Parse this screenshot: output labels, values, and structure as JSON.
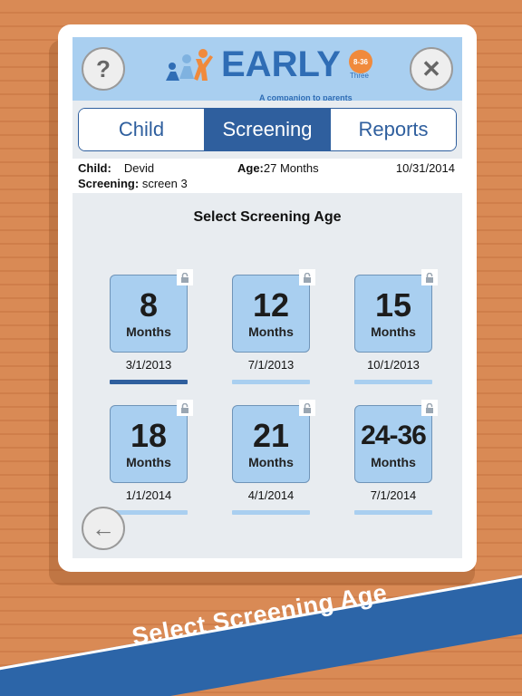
{
  "header": {
    "help_label": "?",
    "close_label": "✕",
    "logo_word": "EARLY",
    "logo_badge": "8-36",
    "logo_three": "Three",
    "tagline": "A companion to parents"
  },
  "tabs": [
    {
      "label": "Child",
      "active": false
    },
    {
      "label": "Screening",
      "active": true
    },
    {
      "label": "Reports",
      "active": false
    }
  ],
  "info": {
    "child_label": "Child:",
    "child_value": "Devid",
    "age_label": "Age:",
    "age_value": "27 Months",
    "date": "10/31/2014",
    "screening_label": "Screening:",
    "screening_value": "screen 3"
  },
  "screening": {
    "title": "Select Screening Age",
    "ages": [
      {
        "number": "8",
        "unit": "Months",
        "date": "3/1/2013",
        "selected": true
      },
      {
        "number": "12",
        "unit": "Months",
        "date": "7/1/2013",
        "selected": false
      },
      {
        "number": "15",
        "unit": "Months",
        "date": "10/1/2013",
        "selected": false
      },
      {
        "number": "18",
        "unit": "Months",
        "date": "1/1/2014",
        "selected": false
      },
      {
        "number": "21",
        "unit": "Months",
        "date": "4/1/2014",
        "selected": false
      },
      {
        "number": "24-36",
        "unit": "Months",
        "date": "7/1/2014",
        "selected": false
      }
    ]
  },
  "back_label": "←",
  "banner": {
    "text": "Select Screening Age"
  },
  "colors": {
    "brand_blue": "#2f5f9e",
    "light_blue": "#a9cff0",
    "accent_orange": "#f08a3c",
    "background_wood": "#d98a55"
  },
  "icons": {
    "help": "question-icon",
    "close": "close-icon",
    "lock": "lock-icon",
    "back": "arrow-left-icon"
  }
}
